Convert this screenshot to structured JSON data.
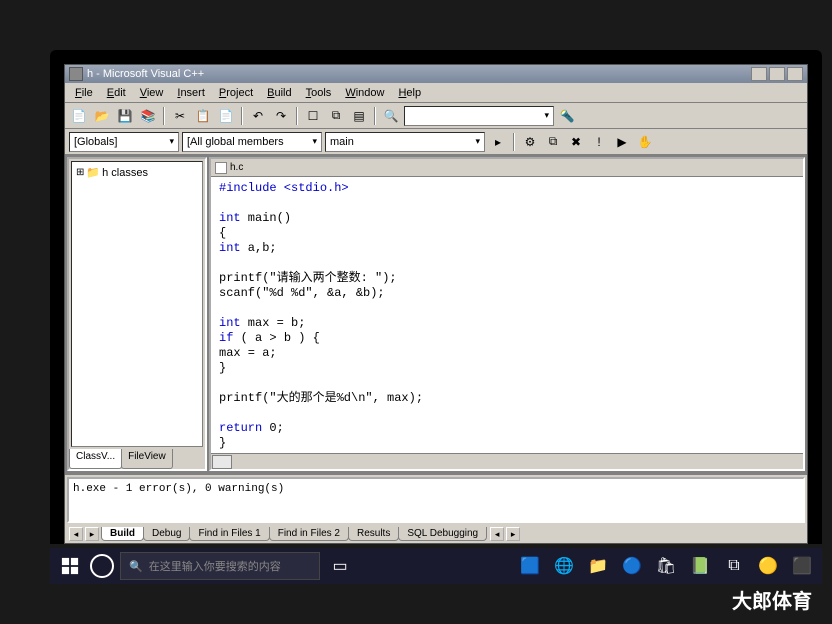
{
  "window": {
    "title": "h - Microsoft Visual C++"
  },
  "menu": [
    "File",
    "Edit",
    "View",
    "Insert",
    "Project",
    "Build",
    "Tools",
    "Window",
    "Help"
  ],
  "toolbar2": {
    "scope": "[Globals]",
    "members": "[All global members",
    "func": "main"
  },
  "sidebar": {
    "tree_root": "h classes",
    "tabs": [
      "ClassV...",
      "FileView"
    ]
  },
  "editor": {
    "filename": "h.c",
    "lines": [
      {
        "t": "pp",
        "s": "#include <stdio.h>"
      },
      {
        "t": "",
        "s": ""
      },
      {
        "t": "mix",
        "s": "int main()",
        "kw": "int"
      },
      {
        "t": "",
        "s": "{"
      },
      {
        "t": "mix",
        "s": "int a,b;",
        "kw": "int"
      },
      {
        "t": "",
        "s": ""
      },
      {
        "t": "",
        "s": "printf(\"请输入两个整数: \");"
      },
      {
        "t": "",
        "s": "scanf(\"%d %d\", &a, &b);"
      },
      {
        "t": "",
        "s": ""
      },
      {
        "t": "mix",
        "s": "int max = b;",
        "kw": "int"
      },
      {
        "t": "mix",
        "s": "if ( a > b ) {",
        "kw": "if"
      },
      {
        "t": "",
        "s": "max = a;"
      },
      {
        "t": "",
        "s": "}"
      },
      {
        "t": "",
        "s": ""
      },
      {
        "t": "",
        "s": "printf(\"大的那个是%d\\n\", max);"
      },
      {
        "t": "",
        "s": ""
      },
      {
        "t": "mix",
        "s": "return 0;",
        "kw": "return"
      },
      {
        "t": "",
        "s": "}"
      }
    ]
  },
  "output": {
    "text": "h.exe - 1 error(s), 0 warning(s)",
    "tabs": [
      "Build",
      "Debug",
      "Find in Files 1",
      "Find in Files 2",
      "Results",
      "SQL Debugging"
    ]
  },
  "taskbar": {
    "search_placeholder": "在这里输入你要搜索的内容"
  },
  "watermark": "大郎体育"
}
